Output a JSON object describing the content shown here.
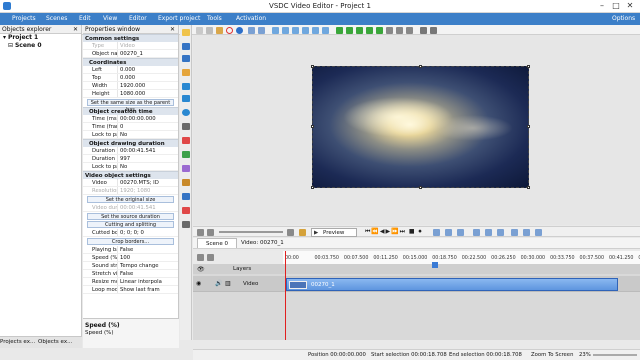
{
  "window": {
    "title": "VSDC Video Editor - Project 1",
    "minimize": "–",
    "maximize": "□",
    "close": "✕"
  },
  "menu": [
    "Projects",
    "Scenes",
    "Edit",
    "View",
    "Editor",
    "Export project",
    "Tools",
    "Activation"
  ],
  "menu_right": "Options",
  "objects_explorer": {
    "title": "Objects explorer",
    "tree": [
      {
        "label": "Project 1"
      },
      {
        "label": "Scene 0"
      }
    ]
  },
  "properties": {
    "title": "Properties window",
    "sections": {
      "common": "Common settings",
      "coordinates": "Coordinates",
      "creation_time": "Object creation time",
      "drawing_duration": "Object drawing duration",
      "video_settings": "Video object settings"
    },
    "common_rows": [
      {
        "k": "Type",
        "v": "Video",
        "dis": true
      },
      {
        "k": "Object name",
        "v": "00270_1",
        "dis": false
      }
    ],
    "coord_rows": [
      {
        "k": "Left",
        "v": "0.000"
      },
      {
        "k": "Top",
        "v": "0.000"
      },
      {
        "k": "Width",
        "v": "1920.000"
      },
      {
        "k": "Height",
        "v": "1080.000"
      }
    ],
    "same_size_btn": "Set the same size as the parent has",
    "creation_rows": [
      {
        "k": "Time (ms)",
        "v": "00:00:00.000"
      },
      {
        "k": "Time (frame)",
        "v": "0"
      },
      {
        "k": "Lock to parer",
        "v": "No"
      }
    ],
    "duration_rows": [
      {
        "k": "Duration (ms)",
        "v": "00:00:41.541"
      },
      {
        "k": "Duration (frar",
        "v": "997"
      },
      {
        "k": "Lock to parer",
        "v": "No"
      }
    ],
    "video_rows": [
      {
        "k": "Video",
        "v": "00270.MTS; ID",
        "dis": false
      },
      {
        "k": "Resolution",
        "v": "1920; 1080",
        "dis": true
      }
    ],
    "original_size_btn": "Set the original size",
    "video_duration_row": {
      "k": "Video duration",
      "v": "00:00:41.541"
    },
    "source_duration_btn": "Set the source duration",
    "cutting_btn": "Cutting and splitting",
    "cutted_row": {
      "k": "Cutted borders",
      "v": "0; 0; 0; 0"
    },
    "crop_btn": "Crop borders...",
    "misc_rows": [
      {
        "k": "Playing backwar",
        "v": "False"
      },
      {
        "k": "Speed (%)",
        "v": "100"
      },
      {
        "k": "Sound stretchin",
        "v": "Tempo change"
      },
      {
        "k": "Stretch video",
        "v": "False"
      },
      {
        "k": "Resize mode",
        "v": "Linear interpola"
      },
      {
        "k": "Loop mode",
        "v": "Show last fram"
      }
    ],
    "help_title": "Speed (%)",
    "help_text": "Speed (%)"
  },
  "left_tabs": [
    "Projects ex...",
    "Objects ex..."
  ],
  "preview_bar": {
    "preview_label": "Preview"
  },
  "timeline": {
    "scene_tab": "Scene 0",
    "video_tab": "Video: 00270_1",
    "layers_label": "Layers",
    "track_label": "Video",
    "clip_label": "00270_1",
    "ruler_ticks": [
      "00:00",
      "00:03.750",
      "00:07.500",
      "00:11.250",
      "00:15.000",
      "00:18.750",
      "00:22.500",
      "00:26.250",
      "00:30.000",
      "00:33.750",
      "00:37.500",
      "00:41.250",
      "00:4"
    ]
  },
  "status": {
    "position": "Position   00:00:00.000",
    "start_sel": "Start selection   00:00:18.708",
    "end_sel": "End selection   00:00:18.708",
    "zoom_to_screen": "Zoom To Screen",
    "zoom_pct": "23%"
  },
  "colors": {
    "menubar": "#3c7fc8",
    "accent_blue": "#2f63b8",
    "playhead": "#e02020"
  }
}
